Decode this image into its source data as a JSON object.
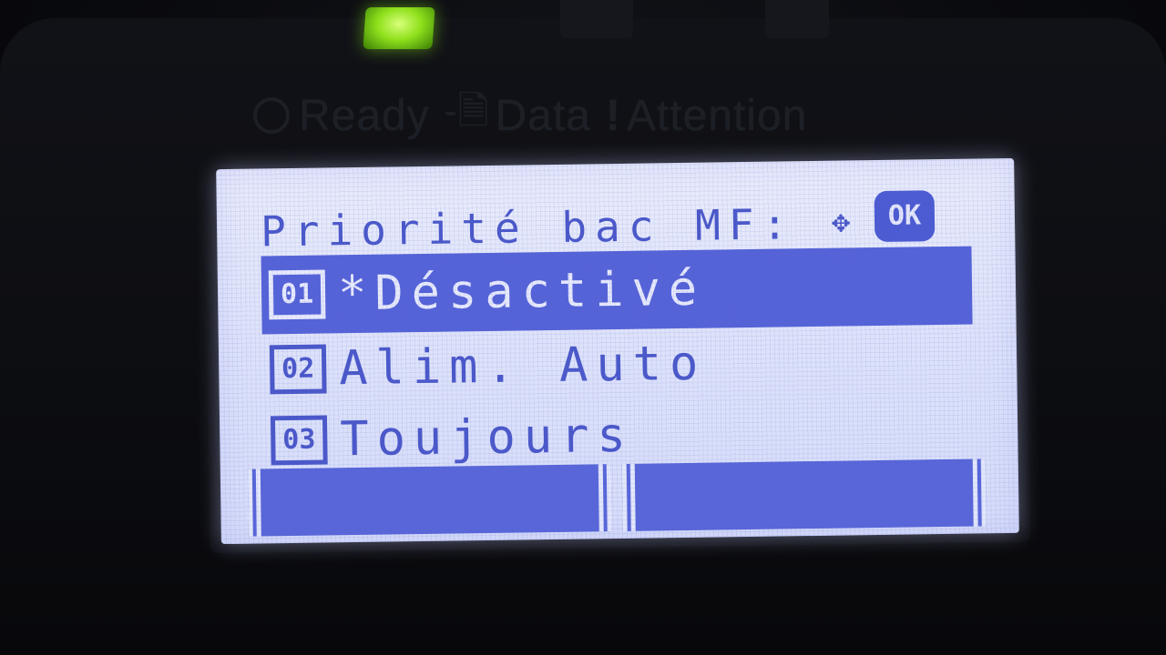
{
  "device": {
    "indicators": {
      "ready": "Ready",
      "data": "Data",
      "attention": "Attention"
    }
  },
  "screen": {
    "title": "Priorité bac MF:",
    "nav_icon": "dpad-arrows-icon",
    "ok_label": "OK",
    "items": [
      {
        "num": "01",
        "label": "*Désactivé",
        "selected": true
      },
      {
        "num": "02",
        "label": " Alim. Auto",
        "selected": false
      },
      {
        "num": "03",
        "label": " Toujours",
        "selected": false
      }
    ],
    "softkeys": [
      {
        "label": ""
      },
      {
        "label": ""
      }
    ]
  },
  "colors": {
    "lcd_background": "#dde2fa",
    "lcd_text": "#4a58c9",
    "highlight": "#5563d8",
    "led_green": "#8fe01c"
  }
}
